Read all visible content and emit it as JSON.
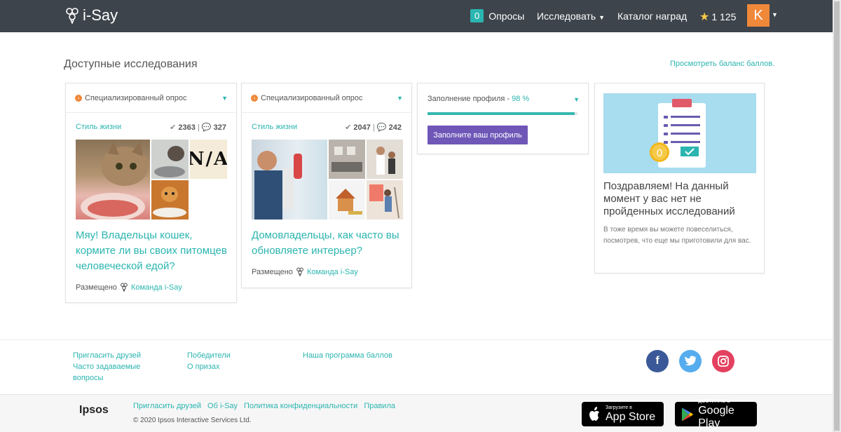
{
  "navbar": {
    "logo_text": "i-Say",
    "surveys_count": "0",
    "surveys_label": "Опросы",
    "explore_label": "Исследовать",
    "catalog_label": "Каталог наград",
    "points": "1 125",
    "avatar_letter": "K"
  },
  "main": {
    "title": "Доступные исследования",
    "balance_link": "Просмотреть баланс баллов."
  },
  "cards": [
    {
      "type": "Специализированный опрос",
      "category": "Стиль жизни",
      "checks": "2363",
      "comments": "327",
      "title": "Мяу! Владельцы кошек, кормите ли вы своих питомцев человеческой едой?",
      "posted_label": "Размещено",
      "team": "Команда i-Say",
      "image_text": "N/A"
    },
    {
      "type": "Специализированный опрос",
      "category": "Стиль жизни",
      "checks": "2047",
      "comments": "242",
      "title": "Домовладельцы, как часто вы обновляете интерьер?",
      "posted_label": "Размещено",
      "team": "Команда i-Say"
    }
  ],
  "profile": {
    "label": "Заполнение профиля - ",
    "percent_text": "98 %",
    "progress": 0.98,
    "button": "Заполните ваш профиль"
  },
  "congrats": {
    "badge": "0",
    "title": "Поздравляем! На данный момент у вас нет не пройденных исследований",
    "text": "В тоже время вы можете повеселиться, посмотрев, что еще мы приготовили для вас."
  },
  "footer": {
    "col1": [
      "Пригласить друзей",
      "Часто задаваемые вопросы"
    ],
    "col2": [
      "Победители",
      "О призах"
    ],
    "col3": [
      "Наша программа баллов"
    ],
    "social": [
      {
        "name": "facebook-icon",
        "glyph": "f",
        "color": "#3b5998"
      },
      {
        "name": "twitter-icon",
        "glyph": "t",
        "color": "#55acee"
      },
      {
        "name": "instagram-icon",
        "glyph": "◎",
        "color": "#e4405f"
      }
    ]
  },
  "bottom": {
    "brand": "Ipsos",
    "links": [
      "Пригласить друзей",
      "Об i-Say",
      "Политика конфиденциальности",
      "Правила"
    ],
    "copyright": "© 2020 Ipsos Interactive Services Ltd.",
    "appstore_small": "Загрузите в",
    "appstore_big": "App Store",
    "googleplay_small": "ДОСТУПНО В",
    "googleplay_big": "Google Play"
  }
}
